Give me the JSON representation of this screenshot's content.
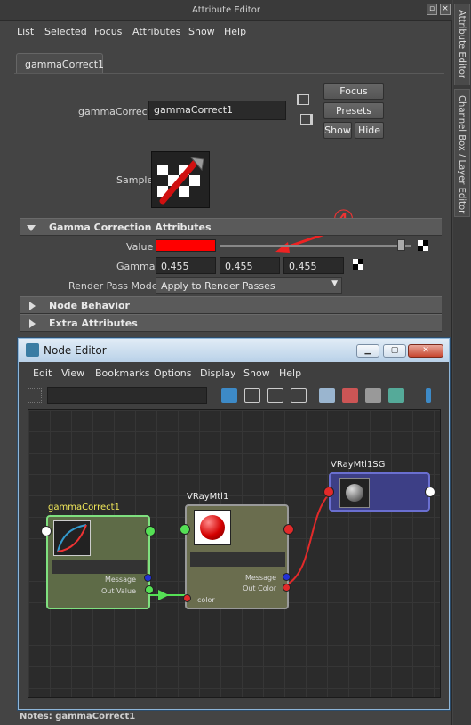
{
  "attribute_editor": {
    "title": "Attribute Editor",
    "menu": [
      "List",
      "Selected",
      "Focus",
      "Attributes",
      "Show",
      "Help"
    ],
    "tab": "gammaCorrect1",
    "node_label": "gammaCorrect:",
    "node_value": "gammaCorrect1",
    "buttons": {
      "focus": "Focus",
      "presets": "Presets",
      "show": "Show",
      "hide": "Hide"
    },
    "sample_label": "Sample",
    "annotation": "④",
    "sections": {
      "gamma": "Gamma Correction Attributes",
      "node_behavior": "Node Behavior",
      "extra": "Extra Attributes"
    },
    "value_label": "Value",
    "value_color": "#ff0000",
    "value_slider": 0.97,
    "gamma_label": "Gamma",
    "gamma": [
      "0.455",
      "0.455",
      "0.455"
    ],
    "render_pass_label": "Render Pass Mode",
    "render_pass_value": "Apply to Render Passes"
  },
  "side_tabs": [
    "Attribute Editor",
    "Channel Box / Layer Editor"
  ],
  "node_editor": {
    "title": "Node Editor",
    "menu": [
      "Edit",
      "View",
      "Bookmarks",
      "Options",
      "Display",
      "Show",
      "Help"
    ],
    "footer": "Notes:  gammaCorrect1",
    "nodes": {
      "gamma": {
        "name": "gammaCorrect1",
        "message": "Message",
        "out": "Out Value"
      },
      "vray": {
        "name": "VRayMtl1",
        "message": "Message",
        "out": "Out Color",
        "in": "color"
      },
      "sg": {
        "name": "VRayMtl1SG"
      }
    }
  },
  "colors": {
    "gamma_node": "#5e6b47",
    "vray_node": "#6a6d4e",
    "sg_node": "#3d3f86",
    "connection_green": "#55e055",
    "connection_red": "#e22a2a"
  }
}
